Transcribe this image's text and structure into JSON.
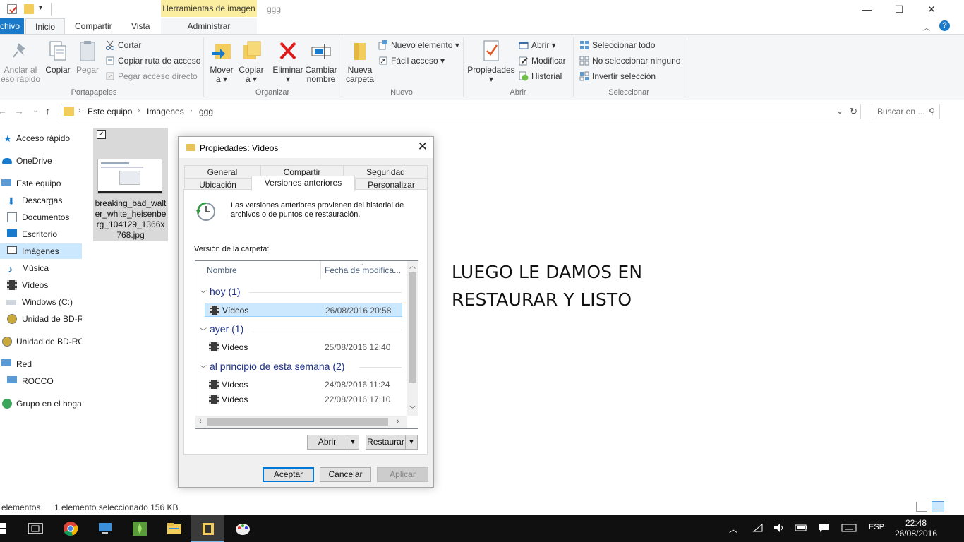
{
  "window": {
    "title": "ggg",
    "context_tab": "Herramientas de imagen",
    "controls": {
      "minimize": "—",
      "maximize": "☐",
      "close": "✕"
    }
  },
  "ribbon_tabs": {
    "file": "chivo",
    "home": "Inicio",
    "share": "Compartir",
    "view": "Vista",
    "manage": "Administrar",
    "help": "?"
  },
  "ribbon": {
    "portapapeles": {
      "label": "Portapapeles",
      "pin": [
        "Anclar al",
        "eso rápido"
      ],
      "copy": "Copiar",
      "paste": "Pegar",
      "cut": "Cortar",
      "copy_path": "Copiar ruta de acceso",
      "paste_shortcut": "Pegar acceso directo"
    },
    "organizar": {
      "label": "Organizar",
      "move": [
        "Mover",
        "a ▾"
      ],
      "copy_to": [
        "Copiar",
        "a ▾"
      ],
      "delete": [
        "Eliminar",
        "▾"
      ],
      "rename": [
        "Cambiar",
        "nombre"
      ]
    },
    "nuevo": {
      "label": "Nuevo",
      "new_folder": [
        "Nueva",
        "carpeta"
      ],
      "new_item": "Nuevo elemento ▾",
      "easy_access": "Fácil acceso ▾"
    },
    "abrir": {
      "label": "Abrir",
      "properties": [
        "Propiedades",
        "▾"
      ],
      "open": "Abrir ▾",
      "edit": "Modificar",
      "history": "Historial"
    },
    "seleccionar": {
      "label": "Seleccionar",
      "select_all": "Seleccionar todo",
      "select_none": "No seleccionar ninguno",
      "invert": "Invertir selección"
    }
  },
  "address": {
    "crumbs": [
      "Este equipo",
      "Imágenes",
      "ggg"
    ],
    "search_placeholder": "Buscar en ..."
  },
  "nav": {
    "items": [
      "Acceso rápido",
      "OneDrive",
      "Este equipo",
      "Descargas",
      "Documentos",
      "Escritorio",
      "Imágenes",
      "Música",
      "Vídeos",
      "Windows (C:)",
      "Unidad de BD-R",
      "Unidad de BD-RO",
      "Red",
      "ROCCO",
      "Grupo en el hoga"
    ]
  },
  "file": {
    "name": "breaking_bad_walter_white_heisenberg_104129_1366x768.jpg",
    "check": "✓"
  },
  "annotation": {
    "line1": "LUEGO LE DAMOS EN",
    "line2": "RESTAURAR Y LISTO"
  },
  "dialog": {
    "title": "Propiedades: Vídeos",
    "close": "✕",
    "tabs": {
      "general": "General",
      "share": "Compartir",
      "security": "Seguridad",
      "location": "Ubicación",
      "previous": "Versiones anteriores",
      "customize": "Personalizar"
    },
    "description": "Las versiones anteriores provienen del historial de archivos o de puntos de restauración.",
    "folder_version_label": "Versión de la carpeta:",
    "columns": {
      "name": "Nombre",
      "date": "Fecha de modifica..."
    },
    "groups": [
      {
        "title": "hoy (1)",
        "rows": [
          {
            "name": "Vídeos",
            "date": "26/08/2016 20:58"
          }
        ]
      },
      {
        "title": "ayer (1)",
        "rows": [
          {
            "name": "Vídeos",
            "date": "25/08/2016 12:40"
          }
        ]
      },
      {
        "title": "al principio de esta semana (2)",
        "rows": [
          {
            "name": "Vídeos",
            "date": "24/08/2016 11:24"
          },
          {
            "name": "Vídeos",
            "date": "22/08/2016 17:10"
          }
        ]
      }
    ],
    "buttons": {
      "open": "Abrir",
      "restore": "Restaurar",
      "ok": "Aceptar",
      "cancel": "Cancelar",
      "apply": "Aplicar"
    }
  },
  "status": {
    "items": "elementos",
    "selection": "1 elemento seleccionado  156 KB"
  },
  "taskbar": {
    "lang": "ESP",
    "time": "22:48",
    "date": "26/08/2016"
  },
  "colors": {
    "accent": "#1979ca",
    "selection": "#cce8ff",
    "context_tab": "#fbeea0",
    "taskbar": "#101010"
  }
}
